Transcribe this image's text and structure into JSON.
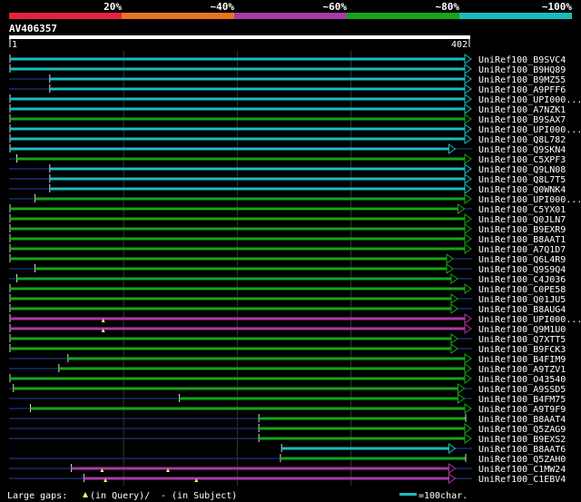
{
  "scale": {
    "labels": [
      "20%",
      "~40%",
      "~60%",
      "~80%",
      "~100%"
    ],
    "colors": [
      "#e8213a",
      "#e8741f",
      "#a93aa6",
      "#16a516",
      "#1bbcbc"
    ]
  },
  "query": {
    "name": "AV406357",
    "start": "1",
    "end": "402",
    "length": 402
  },
  "colors": {
    "cyan": "#1bbcbc",
    "green": "#16a516",
    "purple": "#a93aa6",
    "navy": "#1a2a6a"
  },
  "hits": [
    {
      "label": "UniRef100_B9SVC4",
      "color": "cyan",
      "qs": 1,
      "qe": 402,
      "lead": 0,
      "end": "arrow"
    },
    {
      "label": "UniRef100_B9HQ89",
      "color": "cyan",
      "qs": 1,
      "qe": 402,
      "lead": 0,
      "end": "arrow"
    },
    {
      "label": "UniRef100_B9MZ55",
      "color": "cyan",
      "qs": 36,
      "qe": 402,
      "lead": 1,
      "end": "arrow"
    },
    {
      "label": "UniRef100_A9PFF6",
      "color": "cyan",
      "qs": 36,
      "qe": 402,
      "lead": 1,
      "end": "arrow"
    },
    {
      "label": "UniRef100_UPI000...",
      "color": "cyan",
      "qs": 1,
      "qe": 402,
      "lead": 0,
      "end": "arrow"
    },
    {
      "label": "UniRef100_A7NZK1",
      "color": "cyan",
      "qs": 1,
      "qe": 402,
      "lead": 0,
      "end": "arrow"
    },
    {
      "label": "UniRef100_B9SAX7",
      "color": "green",
      "qs": 1,
      "qe": 402,
      "lead": 0,
      "end": "arrow"
    },
    {
      "label": "UniRef100_UPI000...",
      "color": "cyan",
      "qs": 1,
      "qe": 402,
      "lead": 0,
      "end": "arrow"
    },
    {
      "label": "UniRef100_Q8L782",
      "color": "cyan",
      "qs": 1,
      "qe": 402,
      "lead": 0,
      "end": "arrow"
    },
    {
      "label": "UniRef100_Q9SKN4",
      "color": "cyan",
      "qs": 1,
      "qe": 388,
      "lead": 0,
      "end": "arrow"
    },
    {
      "label": "UniRef100_C5XPF3",
      "color": "green",
      "qs": 7,
      "qe": 402,
      "lead": 1,
      "end": "arrow"
    },
    {
      "label": "UniRef100_Q9LN08",
      "color": "cyan",
      "qs": 36,
      "qe": 402,
      "lead": 1,
      "end": "arrow"
    },
    {
      "label": "UniRef100_Q8L7T5",
      "color": "cyan",
      "qs": 36,
      "qe": 402,
      "lead": 1,
      "end": "arrow"
    },
    {
      "label": "UniRef100_Q0WNK4",
      "color": "cyan",
      "qs": 36,
      "qe": 402,
      "lead": 1,
      "end": "arrow"
    },
    {
      "label": "UniRef100_UPI000...",
      "color": "green",
      "qs": 23,
      "qe": 402,
      "lead": 1,
      "end": "arrow"
    },
    {
      "label": "UniRef100_C5YX01",
      "color": "green",
      "qs": 1,
      "qe": 396,
      "lead": 0,
      "end": "arrow"
    },
    {
      "label": "UniRef100_Q0JLN7",
      "color": "green",
      "qs": 1,
      "qe": 402,
      "lead": 0,
      "end": "arrow"
    },
    {
      "label": "UniRef100_B9EXR9",
      "color": "green",
      "qs": 1,
      "qe": 402,
      "lead": 0,
      "end": "arrow"
    },
    {
      "label": "UniRef100_B8AAT1",
      "color": "green",
      "qs": 1,
      "qe": 402,
      "lead": 0,
      "end": "arrow"
    },
    {
      "label": "UniRef100_A7Q1D7",
      "color": "green",
      "qs": 1,
      "qe": 402,
      "lead": 0,
      "end": "arrow"
    },
    {
      "label": "UniRef100_Q6L4R9",
      "color": "green",
      "qs": 1,
      "qe": 386,
      "lead": 0,
      "end": "arrow"
    },
    {
      "label": "UniRef100_Q9S9Q4",
      "color": "green",
      "qs": 23,
      "qe": 386,
      "lead": 1,
      "end": "arrow"
    },
    {
      "label": "UniRef100_C4J036",
      "color": "green",
      "qs": 7,
      "qe": 390,
      "lead": 1,
      "end": "arrow"
    },
    {
      "label": "UniRef100_C0PE58",
      "color": "green",
      "qs": 1,
      "qe": 402,
      "lead": 0,
      "end": "arrow"
    },
    {
      "label": "UniRef100_Q01JU5",
      "color": "green",
      "qs": 1,
      "qe": 390,
      "lead": 0,
      "end": "arrow"
    },
    {
      "label": "UniRef100_B8AUG4",
      "color": "green",
      "qs": 1,
      "qe": 390,
      "lead": 0,
      "end": "arrow"
    },
    {
      "label": "UniRef100_UPI000...",
      "color": "purple",
      "qs": 1,
      "qe": 402,
      "lead": 0,
      "end": "arrow",
      "gaps": [
        83
      ]
    },
    {
      "label": "UniRef100_Q9M1U0",
      "color": "purple",
      "qs": 1,
      "qe": 402,
      "lead": 0,
      "end": "arrow",
      "gaps": [
        83
      ]
    },
    {
      "label": "UniRef100_Q7XTT5",
      "color": "green",
      "qs": 1,
      "qe": 390,
      "lead": 0,
      "end": "arrow"
    },
    {
      "label": "UniRef100_B9FCK3",
      "color": "green",
      "qs": 1,
      "qe": 390,
      "lead": 0,
      "end": "arrow"
    },
    {
      "label": "UniRef100_B4FIM9",
      "color": "green",
      "qs": 52,
      "qe": 402,
      "lead": 1,
      "end": "arrow"
    },
    {
      "label": "UniRef100_A9TZV1",
      "color": "green",
      "qs": 44,
      "qe": 402,
      "lead": 1,
      "end": "arrow"
    },
    {
      "label": "UniRef100_O43540",
      "color": "green",
      "qs": 1,
      "qe": 402,
      "lead": 0,
      "end": "arrow"
    },
    {
      "label": "UniRef100_A9SSD5",
      "color": "green",
      "qs": 4,
      "qe": 396,
      "lead": 1,
      "end": "arrow"
    },
    {
      "label": "UniRef100_B4FM75",
      "color": "green",
      "qs": 150,
      "qe": 396,
      "lead": 1,
      "end": "arrow"
    },
    {
      "label": "UniRef100_A9T9F9",
      "color": "green",
      "qs": 19,
      "qe": 402,
      "lead": 1,
      "end": "arrow"
    },
    {
      "label": "UniRef100_B8AAT4",
      "color": "green",
      "qs": 220,
      "qe": 402,
      "lead": 1,
      "end": "bar"
    },
    {
      "label": "UniRef100_Q5ZAG9",
      "color": "green",
      "qs": 220,
      "qe": 402,
      "lead": 1,
      "end": "arrow"
    },
    {
      "label": "UniRef100_B9EXS2",
      "color": "green",
      "qs": 220,
      "qe": 402,
      "lead": 1,
      "end": "arrow"
    },
    {
      "label": "UniRef100_B8AAT6",
      "color": "cyan",
      "qs": 240,
      "qe": 388,
      "lead": 0,
      "end": "arrow"
    },
    {
      "label": "UniRef100_Q5ZAH0",
      "color": "green",
      "qs": 239,
      "qe": 402,
      "lead": 1,
      "end": "bar"
    },
    {
      "label": "UniRef100_C1MW24",
      "color": "purple",
      "qs": 55,
      "qe": 388,
      "lead": 1,
      "end": "arrow",
      "gaps": [
        82,
        140
      ]
    },
    {
      "label": "UniRef100_C1EBV4",
      "color": "purple",
      "qs": 66,
      "qe": 388,
      "lead": 1,
      "end": "arrow",
      "gaps": [
        85,
        165
      ]
    }
  ],
  "legend": {
    "text": "Large gaps:",
    "query_text": "(in Query)/",
    "subject_text": "- (in Subject)",
    "scale_text": "=100char."
  }
}
